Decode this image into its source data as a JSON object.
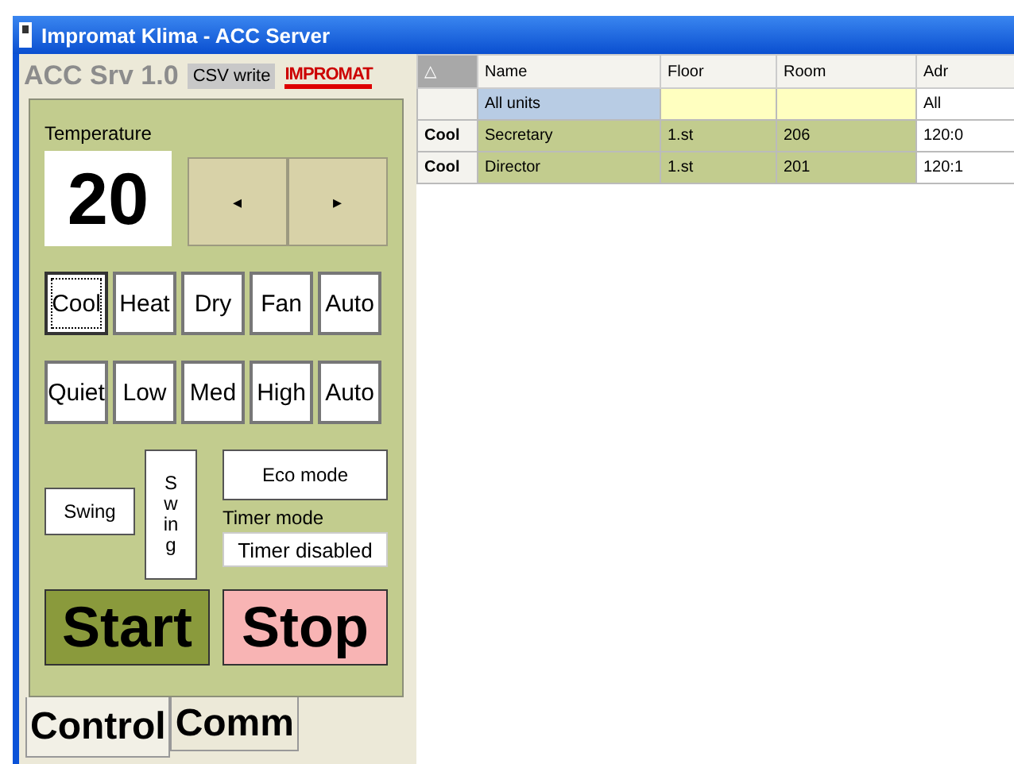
{
  "window": {
    "title": "Impromat Klima - ACC Server"
  },
  "header": {
    "app_name": "ACC Srv 1.0",
    "csv_button": "CSV write",
    "logo": "IMPROMAT"
  },
  "temperature": {
    "label": "Temperature",
    "value": "20",
    "down": "◂",
    "up": "▸"
  },
  "modes": [
    {
      "label": "Cool",
      "selected": true
    },
    {
      "label": "Heat",
      "selected": false
    },
    {
      "label": "Dry",
      "selected": false
    },
    {
      "label": "Fan",
      "selected": false
    },
    {
      "label": "Auto",
      "selected": false
    }
  ],
  "fan_speeds": [
    {
      "label": "Quiet",
      "selected": false
    },
    {
      "label": "Low",
      "selected": false
    },
    {
      "label": "Med",
      "selected": false
    },
    {
      "label": "High",
      "selected": false
    },
    {
      "label": "Auto",
      "selected": false
    }
  ],
  "swing": {
    "horizontal": "Swing",
    "vertical": "Swing"
  },
  "eco_button": "Eco mode",
  "timer": {
    "label": "Timer mode",
    "value": "Timer disabled"
  },
  "start_button": "Start",
  "stop_button": "Stop",
  "tabs": [
    {
      "label": "Control",
      "selected": true
    },
    {
      "label": "Comm",
      "selected": false
    }
  ],
  "table": {
    "sort_indicator": "△",
    "columns": [
      "Name",
      "Floor",
      "Room",
      "Adr"
    ],
    "rows": [
      {
        "kind": "all",
        "mode": "",
        "name": "All units",
        "floor": "",
        "room": "",
        "adr": "All"
      },
      {
        "kind": "unit",
        "mode": "Cool",
        "name": "Secretary",
        "floor": "1.st",
        "room": "206",
        "adr": "120:0"
      },
      {
        "kind": "unit",
        "mode": "Cool",
        "name": "Director",
        "floor": "1.st",
        "room": "201",
        "adr": "120:1"
      }
    ]
  }
}
